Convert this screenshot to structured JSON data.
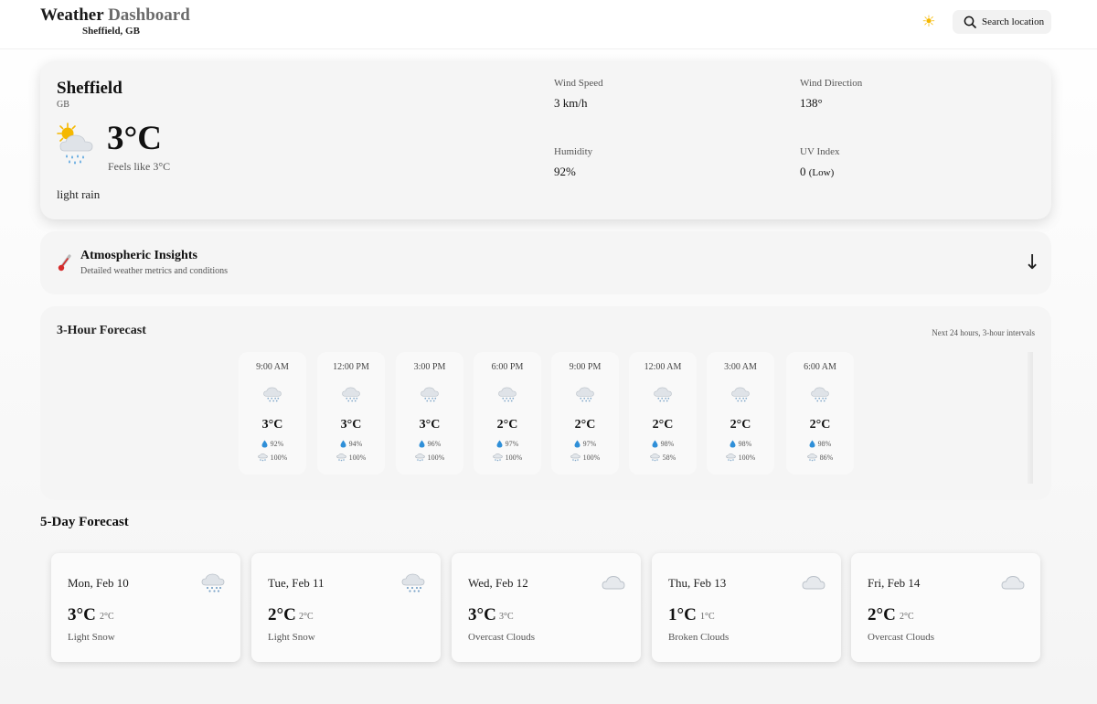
{
  "header": {
    "title_main": "Weather",
    "title_accent": "Dashboard",
    "location": "Sheffield, GB",
    "theme_icon": "sun-icon",
    "search_label": "Search location"
  },
  "current": {
    "city": "Sheffield",
    "country": "GB",
    "temperature": "3°C",
    "feels_like": "Feels like 3°C",
    "condition": "light rain",
    "icon": "sun-cloud-rain-icon",
    "metrics": [
      {
        "label": "Wind Speed",
        "value": "3 km/h",
        "extra": ""
      },
      {
        "label": "Wind Direction",
        "value": "138°",
        "extra": ""
      },
      {
        "label": "Humidity",
        "value": "92%",
        "extra": ""
      },
      {
        "label": "UV Index",
        "value": "0",
        "extra": "(Low)"
      }
    ]
  },
  "insights": {
    "title": "Atmospheric Insights",
    "subtitle": "Detailed weather metrics and conditions",
    "icon": "thermometer-icon",
    "toggle_icon": "arrow-down-icon"
  },
  "hourly": {
    "title": "3-Hour Forecast",
    "note": "Next 24 hours, 3-hour intervals",
    "items": [
      {
        "time": "9:00 AM",
        "temp": "3°C",
        "humidity": "92%",
        "precip": "100%",
        "icon": "cloud-snow-icon"
      },
      {
        "time": "12:00 PM",
        "temp": "3°C",
        "humidity": "94%",
        "precip": "100%",
        "icon": "cloud-snow-icon"
      },
      {
        "time": "3:00 PM",
        "temp": "3°C",
        "humidity": "96%",
        "precip": "100%",
        "icon": "cloud-snow-icon"
      },
      {
        "time": "6:00 PM",
        "temp": "2°C",
        "humidity": "97%",
        "precip": "100%",
        "icon": "cloud-snow-icon"
      },
      {
        "time": "9:00 PM",
        "temp": "2°C",
        "humidity": "97%",
        "precip": "100%",
        "icon": "cloud-snow-icon"
      },
      {
        "time": "12:00 AM",
        "temp": "2°C",
        "humidity": "98%",
        "precip": "58%",
        "icon": "cloud-snow-icon"
      },
      {
        "time": "3:00 AM",
        "temp": "2°C",
        "humidity": "98%",
        "precip": "100%",
        "icon": "cloud-snow-icon"
      },
      {
        "time": "6:00 AM",
        "temp": "2°C",
        "humidity": "98%",
        "precip": "86%",
        "icon": "cloud-snow-icon"
      }
    ]
  },
  "daily": {
    "title": "5-Day Forecast",
    "items": [
      {
        "day": "Mon, Feb 10",
        "max": "3°C",
        "min": "2°C",
        "desc": "Light Snow",
        "icon": "cloud-snow-icon"
      },
      {
        "day": "Tue, Feb 11",
        "max": "2°C",
        "min": "2°C",
        "desc": "Light Snow",
        "icon": "cloud-snow-icon"
      },
      {
        "day": "Wed, Feb 12",
        "max": "3°C",
        "min": "3°C",
        "desc": "Overcast Clouds",
        "icon": "cloud-icon"
      },
      {
        "day": "Thu, Feb 13",
        "max": "1°C",
        "min": "1°C",
        "desc": "Broken Clouds",
        "icon": "cloud-icon"
      },
      {
        "day": "Fri, Feb 14",
        "max": "2°C",
        "min": "2°C",
        "desc": "Overcast Clouds",
        "icon": "cloud-icon"
      }
    ]
  },
  "colors": {
    "card_bg": "#f5f5f5",
    "drop_blue": "#2f8fd8",
    "cloud_gray": "#d9dde2",
    "sun_yellow": "#f5b800"
  }
}
